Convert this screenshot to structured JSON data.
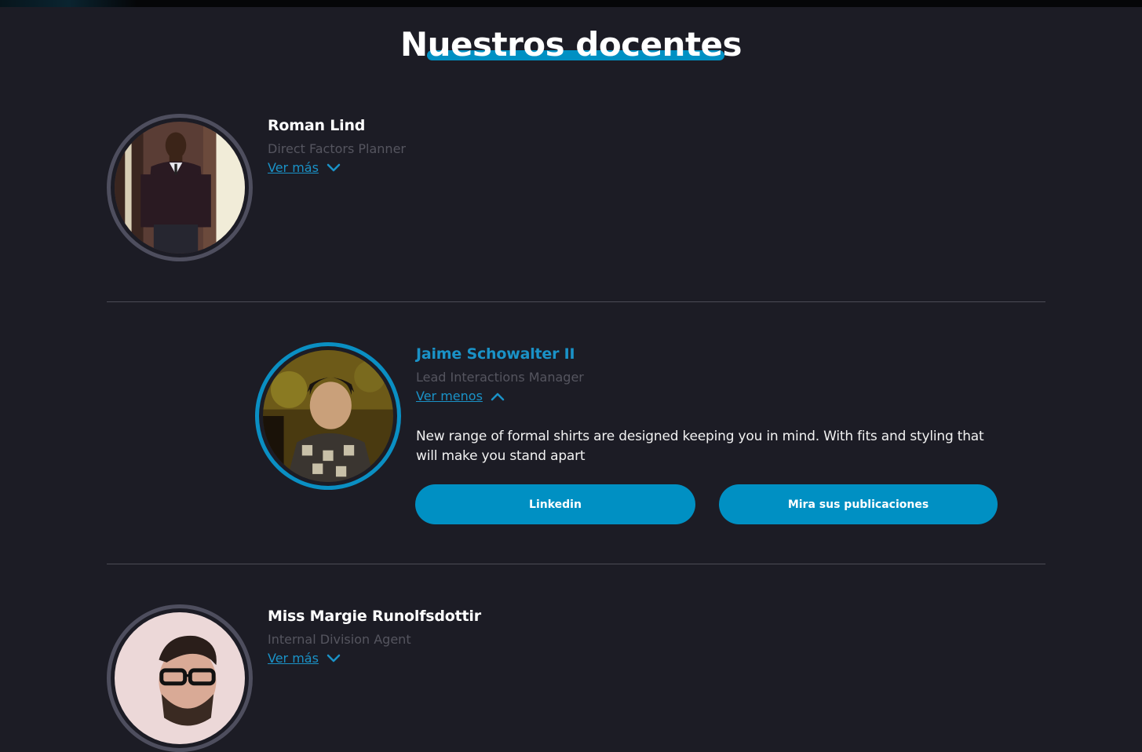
{
  "page": {
    "title": "Nuestros docentes",
    "accent_color": "#0090c3"
  },
  "teachers": [
    {
      "name": "Roman Lind",
      "role": "Direct Factors Planner",
      "toggle_label": "Ver más",
      "toggle_icon": "chevron-down-icon",
      "expanded": false
    },
    {
      "name": "Jaime Schowalter II",
      "role": "Lead Interactions Manager",
      "toggle_label": "Ver menos",
      "toggle_icon": "chevron-up-icon",
      "expanded": true,
      "bio": "New range of formal shirts are designed keeping you in mind. With fits and styling that will make you stand apart",
      "buttons": {
        "linkedin": "Linkedin",
        "publications": "Mira sus publicaciones"
      }
    },
    {
      "name": "Miss Margie Runolfsdottir",
      "role": "Internal Division Agent",
      "toggle_label": "Ver más",
      "toggle_icon": "chevron-down-icon",
      "expanded": false
    }
  ]
}
